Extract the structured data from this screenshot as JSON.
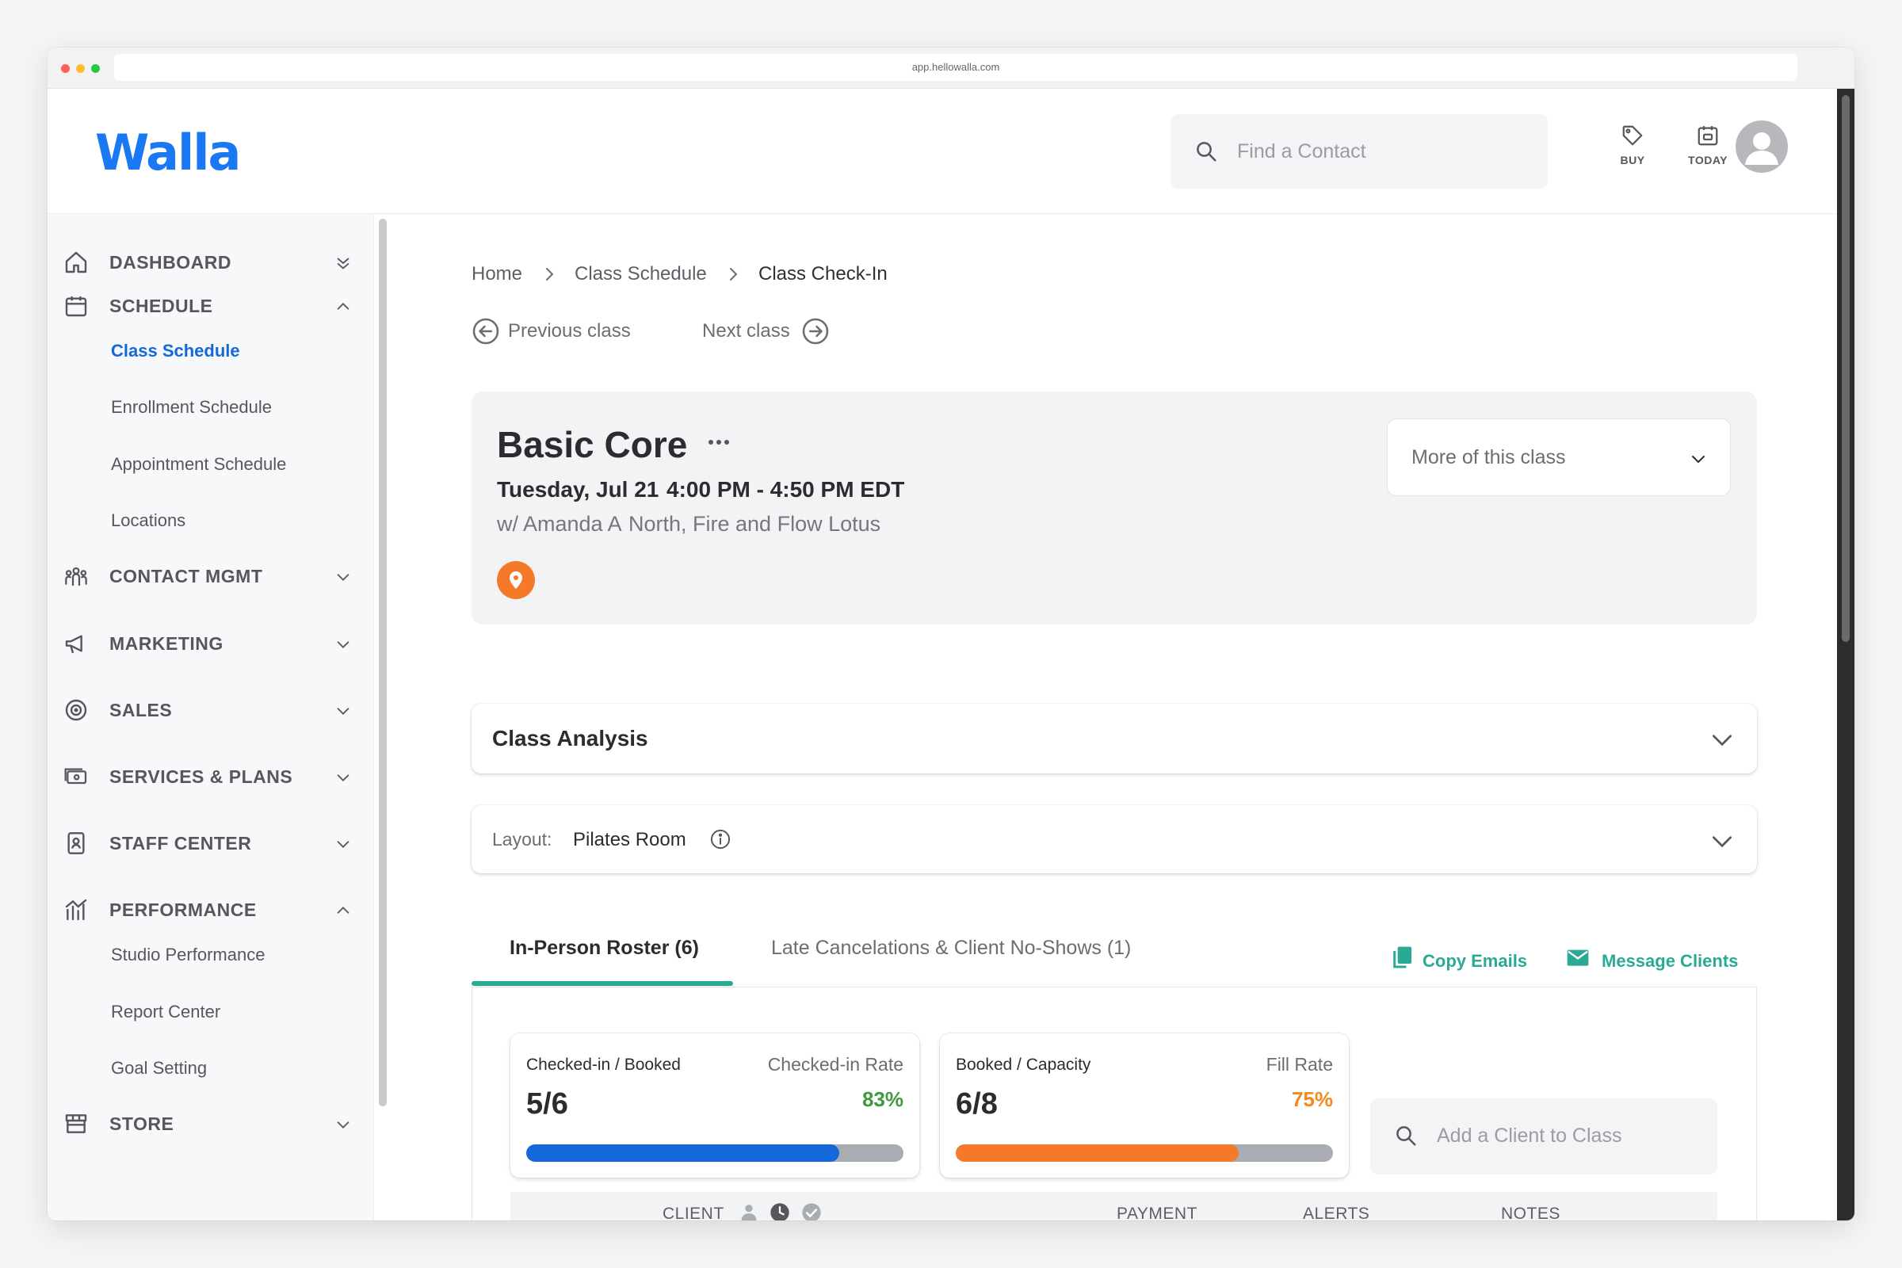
{
  "browser": {
    "url": "app.hellowalla.com"
  },
  "header": {
    "logo": "Walla",
    "search": {
      "placeholder": "Find a Contact",
      "value": ""
    },
    "buy_label": "BUY",
    "today_label": "TODAY"
  },
  "sidebar": {
    "items": [
      {
        "label": "DASHBOARD",
        "icon": "home-icon",
        "expanded": false
      },
      {
        "label": "SCHEDULE",
        "icon": "calendar-icon",
        "expanded": true,
        "children": [
          "Class Schedule",
          "Enrollment Schedule",
          "Appointment Schedule",
          "Locations"
        ],
        "active_child": "Class Schedule"
      },
      {
        "label": "CONTACT MGMT",
        "icon": "people-icon",
        "expanded": false
      },
      {
        "label": "MARKETING",
        "icon": "megaphone-icon",
        "expanded": false
      },
      {
        "label": "SALES",
        "icon": "target-icon",
        "expanded": false
      },
      {
        "label": "SERVICES & PLANS",
        "icon": "ticket-icon",
        "expanded": false
      },
      {
        "label": "STAFF CENTER",
        "icon": "badge-icon",
        "expanded": false
      },
      {
        "label": "PERFORMANCE",
        "icon": "chart-icon",
        "expanded": true,
        "children": [
          "Studio Performance",
          "Report Center",
          "Goal Setting"
        ]
      },
      {
        "label": "STORE",
        "icon": "store-icon",
        "expanded": false
      }
    ]
  },
  "breadcrumbs": [
    "Home",
    "Class Schedule",
    "Class Check-In"
  ],
  "nav": {
    "previous": "Previous class",
    "next": "Next class"
  },
  "class_info": {
    "name": "Basic Core",
    "date": "Tuesday, Jul 21",
    "time": "4:00 PM - 4:50 PM EDT",
    "instructor": "w/ Amanda A",
    "location": "North, Fire and Flow Lotus",
    "more_select": "More of this class"
  },
  "sections": {
    "analysis_title": "Class Analysis",
    "layout_label": "Layout:",
    "layout_value": "Pilates Room"
  },
  "tabs": [
    {
      "label": "In-Person Roster (6)",
      "active": true
    },
    {
      "label": "Late Cancelations & Client No-Shows (1)",
      "active": false
    }
  ],
  "actions": {
    "copy_emails": "Copy Emails",
    "message_clients": "Message Clients"
  },
  "stats": {
    "checked_in": {
      "label": "Checked-in / Booked",
      "rate_label": "Checked-in Rate",
      "value": "5/6",
      "rate": "83%",
      "fraction": 0.83,
      "color": "#1468d9",
      "rate_color": "#3f9a3c"
    },
    "fill": {
      "label": "Booked / Capacity",
      "rate_label": "Fill Rate",
      "value": "6/8",
      "rate": "75%",
      "fraction": 0.75,
      "color": "#f47a29",
      "rate_color": "#f28a1e"
    }
  },
  "add_client": {
    "placeholder": "Add a Client to Class",
    "value": ""
  },
  "table": {
    "columns": [
      "CLIENT",
      "PAYMENT",
      "ALERTS",
      "NOTES"
    ]
  },
  "colors": {
    "brand": "#1a78f2",
    "accent_teal": "#2aaa94",
    "active_link": "#1468d9",
    "pin": "#f47a29"
  }
}
